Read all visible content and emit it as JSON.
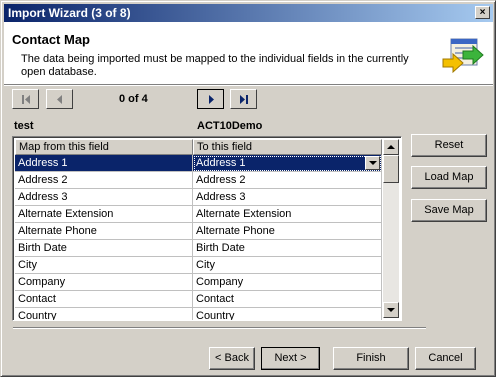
{
  "window": {
    "title": "Import Wizard (3 of 8)",
    "close_glyph": "×"
  },
  "header": {
    "title": "Contact Map",
    "description": "The data being imported must be mapped to the individual fields in the currently open database.",
    "icon": "import-arrows-icon"
  },
  "navigator": {
    "counter": "0 of 4"
  },
  "mapping": {
    "source_label": "test",
    "target_label": "ACT10Demo",
    "columns": [
      "Map from this field",
      "To this field"
    ],
    "rows": [
      {
        "from": "Address 1",
        "to": "Address 1"
      },
      {
        "from": "Address 2",
        "to": "Address 2"
      },
      {
        "from": "Address 3",
        "to": "Address 3"
      },
      {
        "from": "Alternate Extension",
        "to": "Alternate Extension"
      },
      {
        "from": "Alternate Phone",
        "to": "Alternate Phone"
      },
      {
        "from": "Birth Date",
        "to": "Birth Date"
      },
      {
        "from": "City",
        "to": "City"
      },
      {
        "from": "Company",
        "to": "Company"
      },
      {
        "from": "Contact",
        "to": "Contact"
      },
      {
        "from": "Country",
        "to": "Country"
      }
    ]
  },
  "side_buttons": {
    "reset": "Reset",
    "load": "Load Map",
    "save": "Save Map"
  },
  "footer": {
    "back": "< Back",
    "next": "Next >",
    "finish": "Finish",
    "cancel": "Cancel"
  }
}
